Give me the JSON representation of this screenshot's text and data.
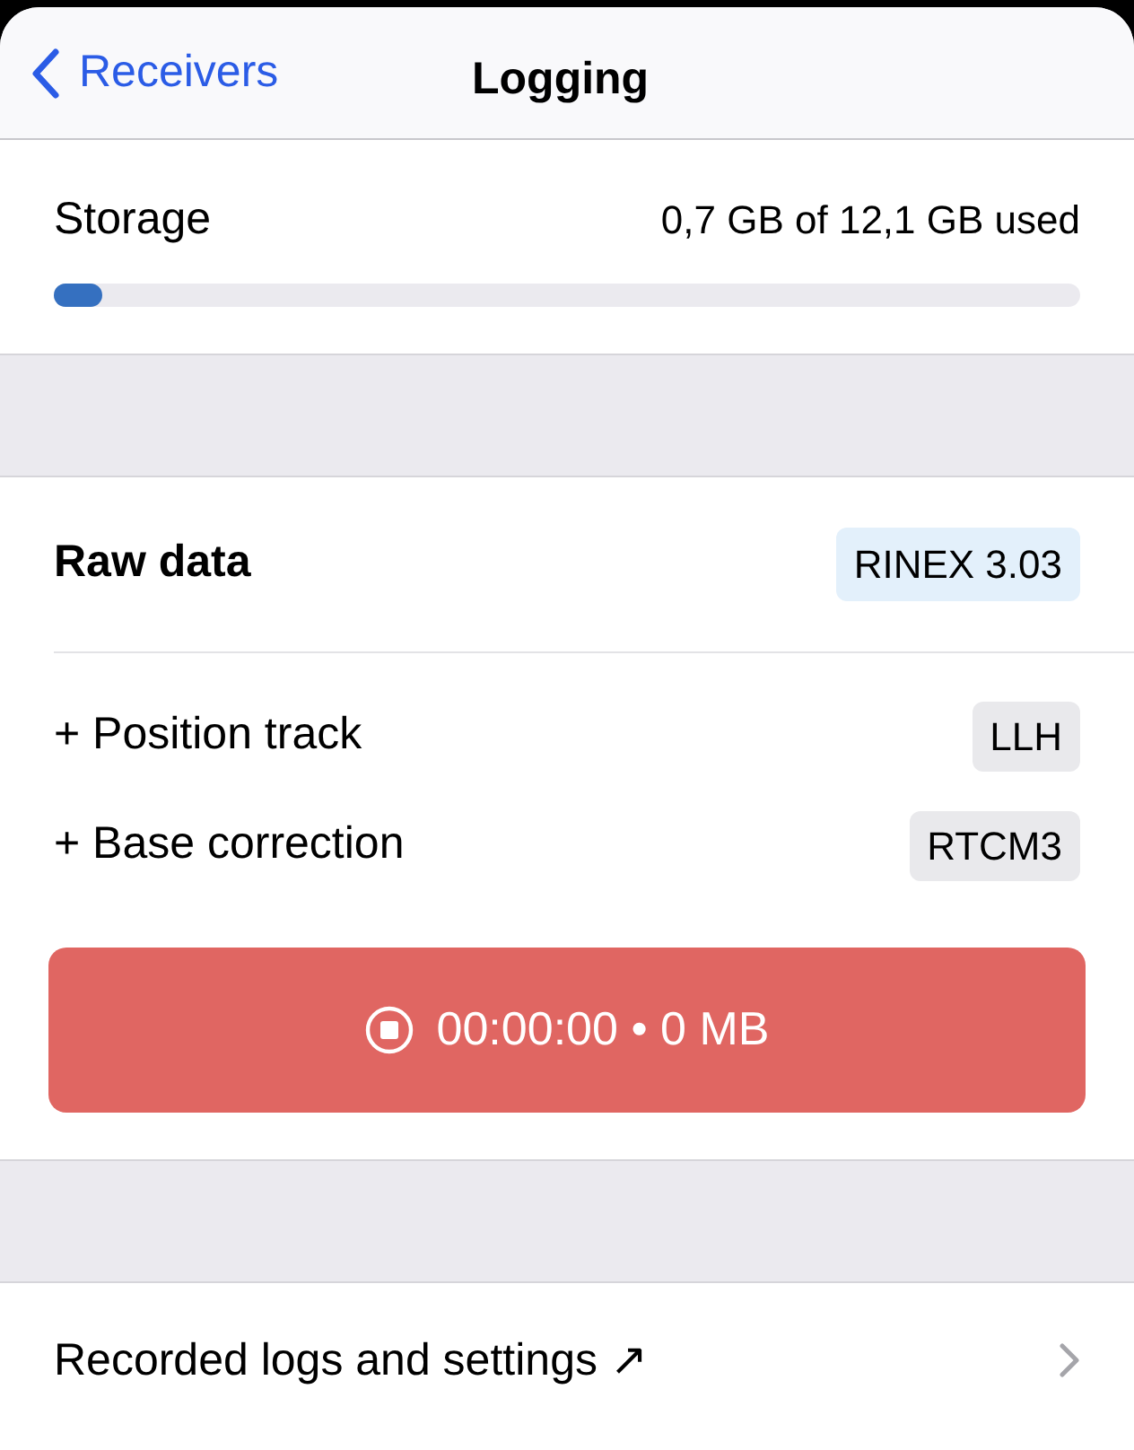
{
  "nav": {
    "back": "Receivers",
    "title": "Logging"
  },
  "storage": {
    "label": "Storage",
    "reading": "0,7 GB of 12,1 GB used",
    "level": 0.047
  },
  "raw_data": {
    "label": "Raw data",
    "format": "RINEX 3.03"
  },
  "extras": [
    {
      "label": "+ Position track",
      "format": "LLH"
    },
    {
      "label": "+ Base correction",
      "format": "RTCM3"
    }
  ],
  "record_button": {
    "kind": "stop",
    "text": "00:00:00 • 0 MB"
  },
  "logs_link": {
    "label": "Recorded logs and settings ↗"
  }
}
